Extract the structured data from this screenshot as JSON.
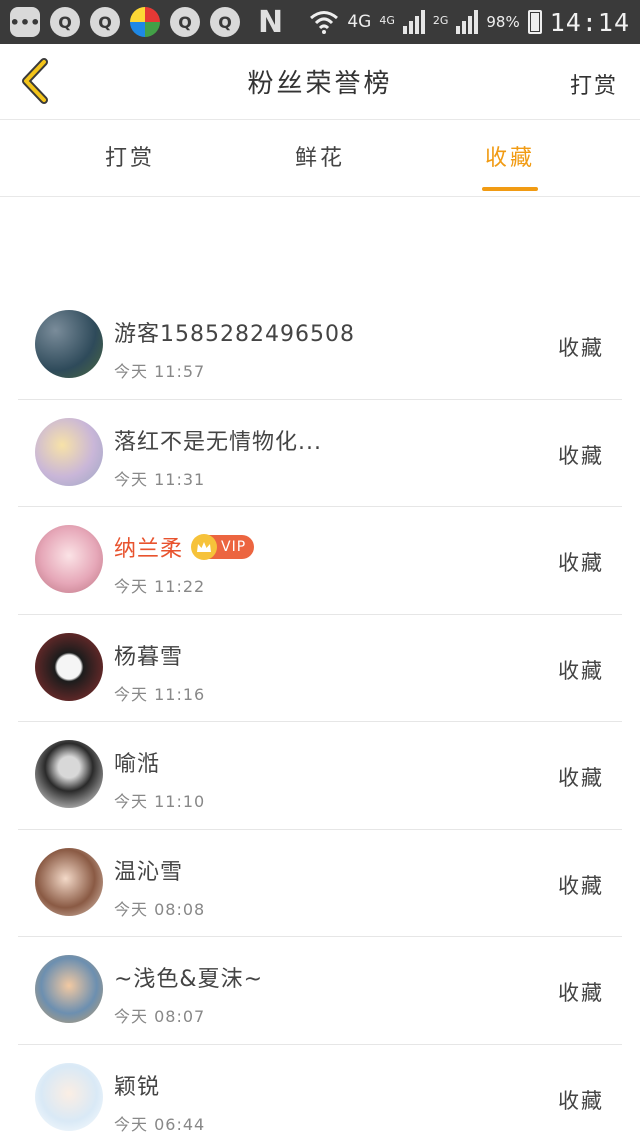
{
  "status_bar": {
    "network_label": "4G",
    "sim1_label": "4G",
    "sim2_label": "2G",
    "battery": "98%",
    "time": "14:14",
    "n_icon": "N"
  },
  "header": {
    "title": "粉丝荣誉榜",
    "action_label": "打赏"
  },
  "tabs": [
    {
      "label": "打赏",
      "active": false
    },
    {
      "label": "鲜花",
      "active": false
    },
    {
      "label": "收藏",
      "active": true
    }
  ],
  "fans": [
    {
      "name": "游客1585282496508",
      "time": "今天 11:57",
      "action": "收藏",
      "vip": false
    },
    {
      "name": "落红不是无情物化...",
      "time": "今天 11:31",
      "action": "收藏",
      "vip": false
    },
    {
      "name": "纳兰柔",
      "time": "今天 11:22",
      "action": "收藏",
      "vip": true,
      "vip_label": "VIP"
    },
    {
      "name": "杨暮雪",
      "time": "今天 11:16",
      "action": "收藏",
      "vip": false
    },
    {
      "name": "喻湉",
      "time": "今天 11:10",
      "action": "收藏",
      "vip": false
    },
    {
      "name": "温沁雪",
      "time": "今天 08:08",
      "action": "收藏",
      "vip": false
    },
    {
      "name": "~浅色&夏沫~",
      "time": "今天 08:07",
      "action": "收藏",
      "vip": false
    },
    {
      "name": "颖锐",
      "time": "今天 06:44",
      "action": "收藏",
      "vip": false
    }
  ],
  "colors": {
    "accent": "#f19b13",
    "vip_name": "#e8532e",
    "vip_badge": "#ec6540",
    "status_bar": "#3a3a3a"
  }
}
